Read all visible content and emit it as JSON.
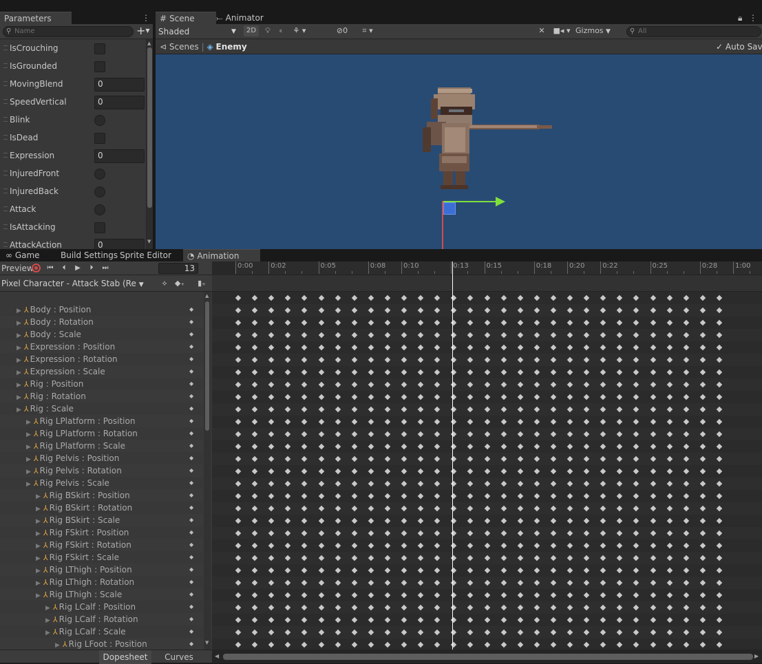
{
  "parameters_panel": {
    "tab_label": "Parameters",
    "search_placeholder": "Name",
    "add_label": "+",
    "items": [
      {
        "name": "IsCrouching",
        "kind": "bool"
      },
      {
        "name": "IsGrounded",
        "kind": "bool"
      },
      {
        "name": "MovingBlend",
        "kind": "number",
        "value": "0"
      },
      {
        "name": "SpeedVertical",
        "kind": "number",
        "value": "0"
      },
      {
        "name": "Blink",
        "kind": "trigger"
      },
      {
        "name": "IsDead",
        "kind": "bool"
      },
      {
        "name": "Expression",
        "kind": "number",
        "value": "0"
      },
      {
        "name": "InjuredFront",
        "kind": "trigger"
      },
      {
        "name": "InjuredBack",
        "kind": "trigger"
      },
      {
        "name": "Attack",
        "kind": "trigger"
      },
      {
        "name": "IsAttacking",
        "kind": "bool"
      },
      {
        "name": "AttackAction",
        "kind": "number",
        "value": "0"
      }
    ]
  },
  "scene_view": {
    "tabs": [
      {
        "label": "Scene",
        "icon": "grid-icon"
      },
      {
        "label": "Animator",
        "icon": "animator-icon"
      }
    ],
    "shading_mode": "Shaded",
    "mode_2d": "2D",
    "hidden_count": "0",
    "gizmos_label": "Gizmos",
    "search_placeholder": "All",
    "breadcrumb_root": "Scenes",
    "breadcrumb_current": "Enemy",
    "auto_save_label": "Auto Save"
  },
  "bottom_tabs": [
    {
      "label": "Game",
      "icon": "gamepad-icon"
    },
    {
      "label": "Build Settings"
    },
    {
      "label": "Sprite Editor"
    },
    {
      "label": "Animation",
      "icon": "clock-icon"
    }
  ],
  "animation": {
    "preview_label": "Preview",
    "frame_value": "13",
    "clip_name": "Pixel Character - Attack Stab (Re",
    "dopesheet_label": "Dopesheet",
    "curves_label": "Curves",
    "time_labels": [
      "0:00",
      "0:02",
      "0:05",
      "0:08",
      "0:10",
      "0:13",
      "0:15",
      "0:18",
      "0:20",
      "0:22",
      "0:25",
      "0:28",
      "1:00"
    ],
    "properties": [
      {
        "label": "Body : Position",
        "indent": 0
      },
      {
        "label": "Body : Rotation",
        "indent": 0
      },
      {
        "label": "Body : Scale",
        "indent": 0
      },
      {
        "label": "Expression : Position",
        "indent": 0
      },
      {
        "label": "Expression : Rotation",
        "indent": 0
      },
      {
        "label": "Expression : Scale",
        "indent": 0
      },
      {
        "label": "Rig  : Position",
        "indent": 0
      },
      {
        "label": "Rig  : Rotation",
        "indent": 0
      },
      {
        "label": "Rig  : Scale",
        "indent": 0
      },
      {
        "label": "Rig LPlatform : Position",
        "indent": 1
      },
      {
        "label": "Rig LPlatform : Rotation",
        "indent": 1
      },
      {
        "label": "Rig LPlatform : Scale",
        "indent": 1
      },
      {
        "label": "Rig Pelvis : Position",
        "indent": 1
      },
      {
        "label": "Rig Pelvis : Rotation",
        "indent": 1
      },
      {
        "label": "Rig Pelvis : Scale",
        "indent": 1
      },
      {
        "label": "Rig BSkirt : Position",
        "indent": 2
      },
      {
        "label": "Rig BSkirt : Rotation",
        "indent": 2
      },
      {
        "label": "Rig BSkirt : Scale",
        "indent": 2
      },
      {
        "label": "Rig FSkirt : Position",
        "indent": 2
      },
      {
        "label": "Rig FSkirt : Rotation",
        "indent": 2
      },
      {
        "label": "Rig FSkirt : Scale",
        "indent": 2
      },
      {
        "label": "Rig LThigh : Position",
        "indent": 2
      },
      {
        "label": "Rig LThigh : Rotation",
        "indent": 2
      },
      {
        "label": "Rig LThigh : Scale",
        "indent": 2
      },
      {
        "label": "Rig LCalf : Position",
        "indent": 3
      },
      {
        "label": "Rig LCalf : Rotation",
        "indent": 3
      },
      {
        "label": "Rig LCalf : Scale",
        "indent": 3
      },
      {
        "label": "Rig LFoot : Position",
        "indent": 4
      }
    ]
  },
  "colors": {
    "scene_background": "#284b74",
    "playhead": "#ffffff",
    "record_button": "#d24a4a",
    "move_gizmo_x": "#7fe03a",
    "move_gizmo_y": "#d74a4a"
  }
}
